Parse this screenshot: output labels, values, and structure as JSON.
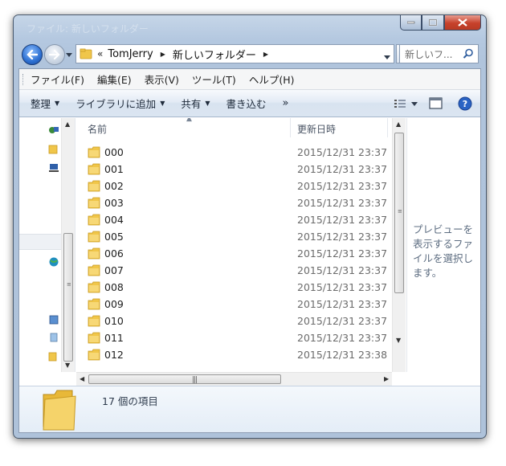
{
  "window": {
    "title_ghost": "ファイル: 新しいフォルダー"
  },
  "address": {
    "overflow": "«",
    "crumbs": [
      "TomJerry",
      "新しいフォルダー"
    ]
  },
  "search": {
    "placeholder": "新しいフ..."
  },
  "menubar": {
    "items": [
      "ファイル(F)",
      "編集(E)",
      "表示(V)",
      "ツール(T)",
      "ヘルプ(H)"
    ]
  },
  "toolbar": {
    "organize": "整理",
    "include_library": "ライブラリに追加",
    "share": "共有",
    "burn": "書き込む",
    "more": "»"
  },
  "columns": {
    "name": "名前",
    "date": "更新日時"
  },
  "files": [
    {
      "name": "000",
      "date": "2015/12/31 23:37"
    },
    {
      "name": "001",
      "date": "2015/12/31 23:37"
    },
    {
      "name": "002",
      "date": "2015/12/31 23:37"
    },
    {
      "name": "003",
      "date": "2015/12/31 23:37"
    },
    {
      "name": "004",
      "date": "2015/12/31 23:37"
    },
    {
      "name": "005",
      "date": "2015/12/31 23:37"
    },
    {
      "name": "006",
      "date": "2015/12/31 23:37"
    },
    {
      "name": "007",
      "date": "2015/12/31 23:37"
    },
    {
      "name": "008",
      "date": "2015/12/31 23:37"
    },
    {
      "name": "009",
      "date": "2015/12/31 23:37"
    },
    {
      "name": "010",
      "date": "2015/12/31 23:37"
    },
    {
      "name": "011",
      "date": "2015/12/31 23:37"
    },
    {
      "name": "012",
      "date": "2015/12/31 23:38"
    }
  ],
  "preview": {
    "message": "プレビューを表示するファイルを選択します。"
  },
  "details": {
    "item_count": "17 個の項目"
  },
  "colors": {
    "frame": "#b4c8e0",
    "folder": "#f0c64a",
    "close": "#c6412b"
  }
}
